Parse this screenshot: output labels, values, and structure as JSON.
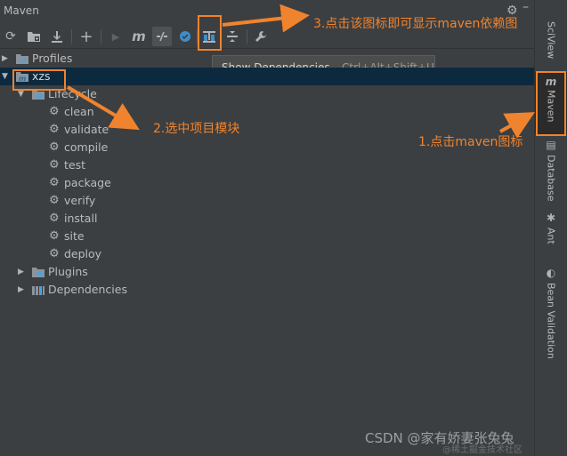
{
  "window": {
    "title": "Maven"
  },
  "toolbar": {
    "buttons": [
      {
        "name": "reload",
        "glyph": "⟳"
      },
      {
        "name": "add-folder",
        "glyph": "▣"
      },
      {
        "name": "download",
        "glyph": "⤓"
      },
      {
        "name": "add",
        "glyph": "+"
      },
      {
        "name": "run",
        "glyph": "▶"
      },
      {
        "name": "execute-goal",
        "glyph": "m"
      },
      {
        "name": "toggle-offline",
        "glyph": "⫽"
      },
      {
        "name": "skip-tests",
        "glyph": "●"
      },
      {
        "name": "show-dependencies",
        "glyph": "⊤"
      },
      {
        "name": "collapse-all",
        "glyph": "⇕"
      },
      {
        "name": "settings",
        "glyph": "🔧"
      }
    ]
  },
  "tooltip": {
    "label": "Show Dependencies...",
    "shortcut": "Ctrl+Alt+Shift+U"
  },
  "tree": {
    "profiles": "Profiles",
    "project": "xzs",
    "lifecycle": "Lifecycle",
    "phases": [
      "clean",
      "validate",
      "compile",
      "test",
      "package",
      "verify",
      "install",
      "site",
      "deploy"
    ],
    "plugins": "Plugins",
    "dependencies": "Dependencies"
  },
  "right_strip": {
    "tabs": [
      "SciView",
      "Maven",
      "Database",
      "Ant",
      "Bean Validation"
    ],
    "maven_icon": "m"
  },
  "annotations": {
    "step1": "1.点击maven图标",
    "step2": "2.选中项目模块",
    "step3": "3.点击该图标即可显示maven依赖图"
  },
  "watermark": {
    "main": "CSDN @家有娇妻张兔兔",
    "sub": "@稀土掘金技术社区"
  },
  "colors": {
    "background": "#3c3f41",
    "selection": "#0d293e",
    "annotation": "#f0832d",
    "text": "#bbbbbb"
  }
}
